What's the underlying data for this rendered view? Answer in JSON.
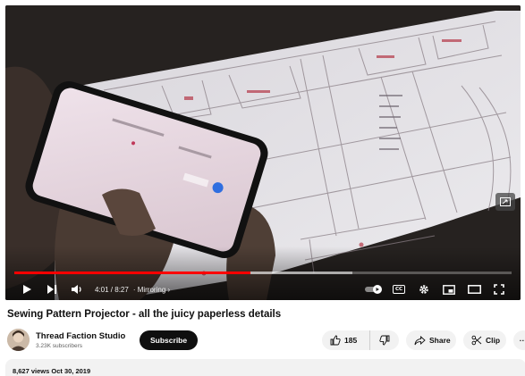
{
  "player": {
    "time_display": "4:01 / 8:27",
    "chapter_label": "Mirroring",
    "progress_fraction": 0.475,
    "buffer_fraction": 0.68,
    "cc_label": "CC"
  },
  "video": {
    "title": "Sewing Pattern Projector - all the juicy paperless details"
  },
  "channel": {
    "name": "Thread Faction Studio",
    "subscribers": "3.23K subscribers",
    "subscribe_label": "Subscribe"
  },
  "actions": {
    "like_count": "185",
    "share_label": "Share",
    "clip_label": "Clip",
    "more_label": "···"
  },
  "description": {
    "meta": "8,627 views  Oct 30, 2019"
  },
  "colors": {
    "progress_red": "#ff0000",
    "subscribe_bg": "#0f0f0f",
    "pill_bg": "#f2f2f2"
  },
  "icons": {
    "play": "play-icon",
    "next": "next-icon",
    "volume": "volume-icon",
    "autoplay": "autoplay-toggle-icon",
    "captions": "captions-icon",
    "settings": "gear-icon",
    "miniplayer": "miniplayer-icon",
    "theater": "theater-mode-icon",
    "fullscreen": "fullscreen-icon",
    "like": "thumbs-up-icon",
    "dislike": "thumbs-down-icon",
    "share": "share-icon",
    "clip": "scissors-icon"
  }
}
